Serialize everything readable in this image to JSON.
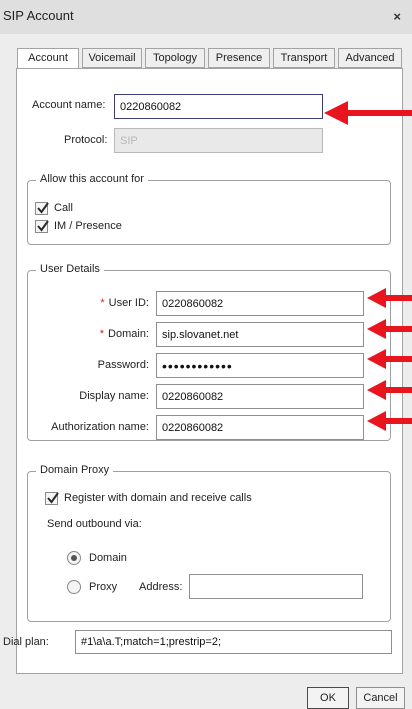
{
  "window": {
    "title": "SIP Account",
    "close_glyph": "×"
  },
  "tabs": [
    {
      "label": "Account",
      "active": true
    },
    {
      "label": "Voicemail"
    },
    {
      "label": "Topology"
    },
    {
      "label": "Presence"
    },
    {
      "label": "Transport"
    },
    {
      "label": "Advanced"
    }
  ],
  "account": {
    "name_label": "Account name:",
    "name_value": "0220860082",
    "protocol_label": "Protocol:",
    "protocol_value": "SIP"
  },
  "allow": {
    "legend": "Allow this account for",
    "call_label": "Call",
    "call_checked": true,
    "im_label": "IM / Presence",
    "im_checked": true
  },
  "user_details": {
    "legend": "User Details",
    "required_marker": "*",
    "user_id_label": "User ID:",
    "user_id_value": "0220860082",
    "domain_label": "Domain:",
    "domain_value": "sip.slovanet.net",
    "password_label": "Password:",
    "password_value": "••••••••••••",
    "display_name_label": "Display name:",
    "display_name_value": "0220860082",
    "auth_name_label": "Authorization name:",
    "auth_name_value": "0220860082"
  },
  "domain_proxy": {
    "legend": "Domain Proxy",
    "register_label": "Register with domain and receive calls",
    "register_checked": true,
    "send_label": "Send outbound via:",
    "domain_option": "Domain",
    "proxy_option": "Proxy",
    "selected_option": "Domain",
    "address_label": "Address:",
    "address_value": ""
  },
  "dial_plan": {
    "label": "Dial plan:",
    "value": "#1\\a\\a.T;match=1;prestrip=2;"
  },
  "buttons": {
    "ok": "OK",
    "cancel": "Cancel"
  },
  "annotation_color": "#e8141e",
  "icons": [
    "close-icon",
    "checkmark-icon",
    "radio-dot-icon",
    "red-arrow-icon"
  ]
}
